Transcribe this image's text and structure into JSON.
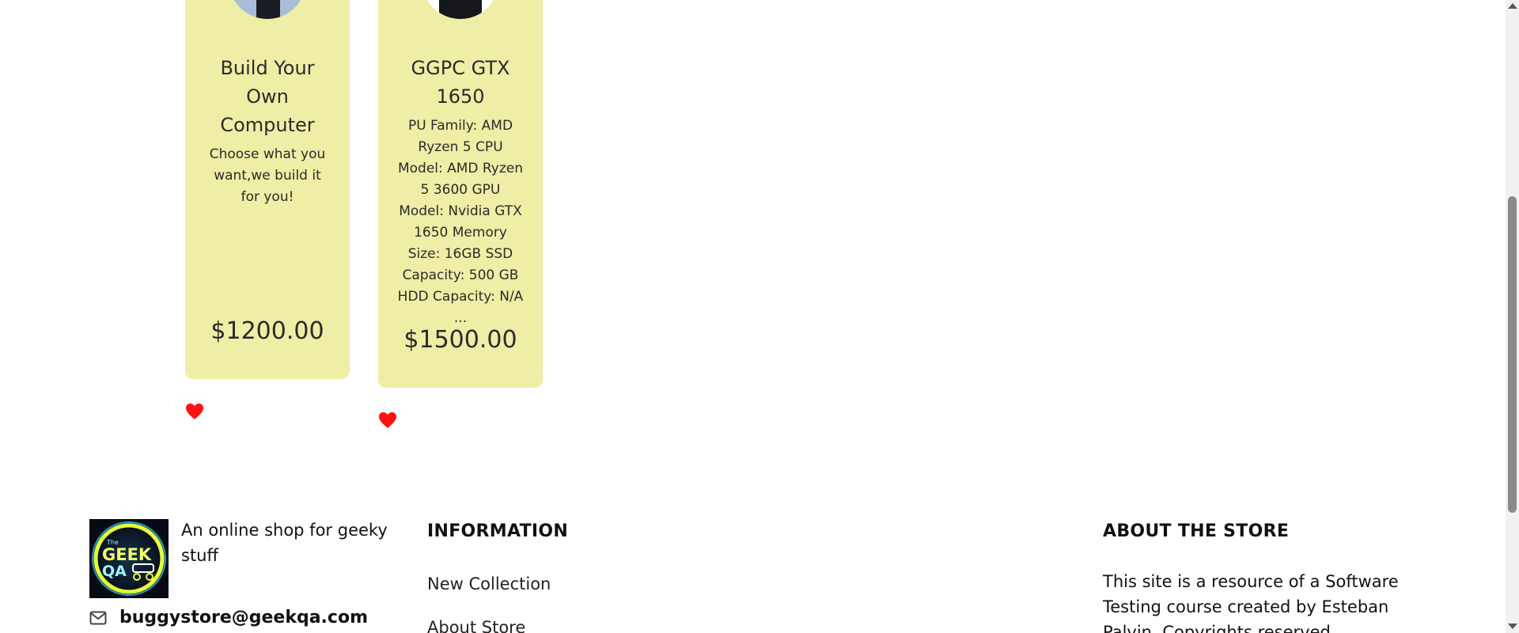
{
  "products": [
    {
      "title": "Build Your Own Computer",
      "description": "Choose what you want,we build it for you!",
      "price": "$1200.00",
      "favorite": true
    },
    {
      "title": "GGPC GTX 1650",
      "description": "PU Family: AMD Ryzen 5 CPU Model: AMD Ryzen 5 3600 GPU Model: Nvidia GTX 1650 Memory Size: 16GB SSD Capacity: 500 GB HDD Capacity: N/A ...",
      "price": "$1500.00",
      "favorite": true
    }
  ],
  "footer": {
    "logo_text_small": "The",
    "logo_text_line1": "GEEK",
    "logo_text_line2": "QA",
    "tagline": "An online shop for geeky stuff",
    "email": "buggystore@geekqa.com",
    "information": {
      "heading": "INFORMATION",
      "links": [
        "New Collection",
        "About Store"
      ]
    },
    "about": {
      "heading": "ABOUT THE STORE",
      "text": "This site is a resource of a Software Testing course created by Esteban Palvin. Copyrights reserved."
    }
  },
  "colors": {
    "card_bg": "#eeeea6",
    "heart": "#ff1111",
    "text": "#2b2b2b"
  },
  "icons": {
    "favorite": "heart-icon",
    "email": "mail-icon"
  }
}
